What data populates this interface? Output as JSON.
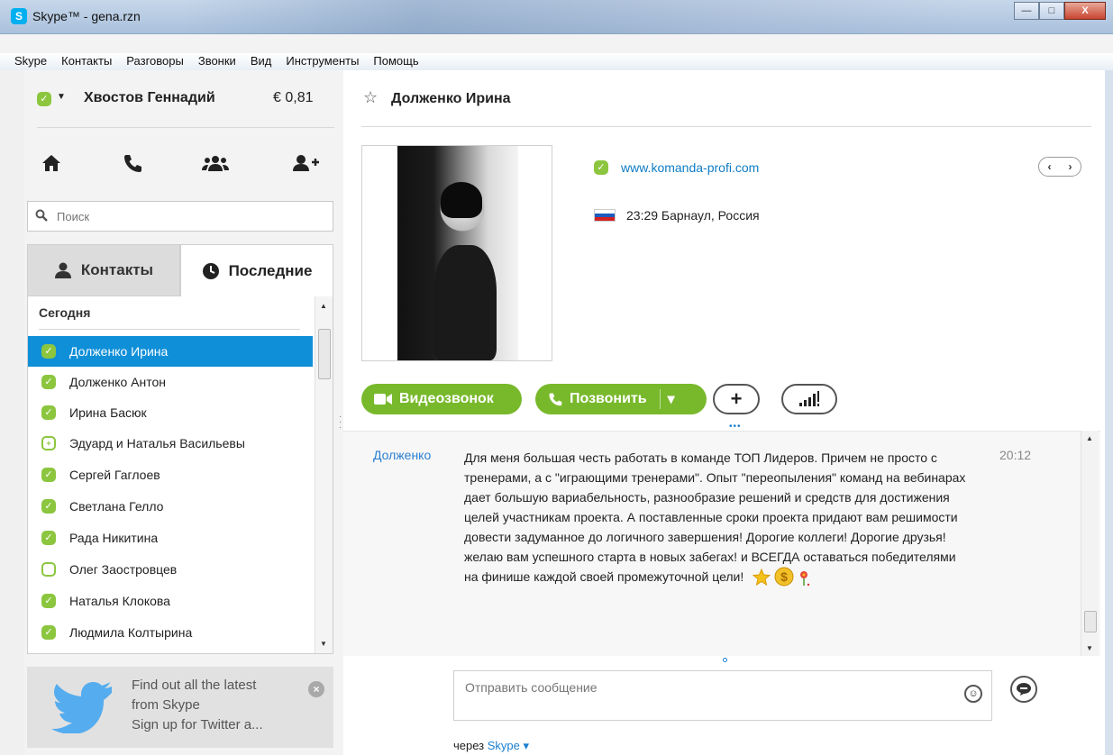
{
  "window": {
    "title": "Skype™ - gena.rzn",
    "logo_letter": "S",
    "minimize": "—",
    "maximize": "□",
    "close": "X"
  },
  "menu": [
    "Skype",
    "Контакты",
    "Разговоры",
    "Звонки",
    "Вид",
    "Инструменты",
    "Помощь"
  ],
  "profile": {
    "name": "Хвостов Геннадий",
    "credit": "€ 0,81",
    "status_color": "#8cc63f"
  },
  "search": {
    "placeholder": "Поиск"
  },
  "tabs": {
    "contacts": "Контакты",
    "recent": "Последние"
  },
  "recent_group": "Сегодня",
  "contacts": [
    {
      "name": "Долженко Ирина",
      "status": "online",
      "active": true
    },
    {
      "name": "Долженко Антон",
      "status": "online"
    },
    {
      "name": "Ирина Басюк",
      "status": "online"
    },
    {
      "name": "Эдуард и Наталья Васильевы",
      "status": "group"
    },
    {
      "name": "Сергей Гаглоев",
      "status": "online"
    },
    {
      "name": "Светлана Гелло",
      "status": "online"
    },
    {
      "name": "Рада Никитина",
      "status": "online"
    },
    {
      "name": "Олег  Заостровцев",
      "status": "offline"
    },
    {
      "name": "Наталья Клокова",
      "status": "online"
    },
    {
      "name": "Людмила Колтырина",
      "status": "online"
    }
  ],
  "twitter": {
    "line1": "Find out all the latest",
    "line2": "from Skype",
    "line3": "Sign up for Twitter a..."
  },
  "conversation": {
    "name": "Долженко Ирина",
    "website": "www.komanda-profi.com",
    "local_time": "23:29 Барнаул, Россия",
    "video_button": "Видеозвонок",
    "call_button": "Позвонить"
  },
  "message": {
    "author": "Долженко",
    "time": "20:12",
    "text": "Для меня большая честь работать в команде ТОП Лидеров. Причем не просто с тренерами, а с \"играющими тренерами\". Опыт \"переопыления\" команд на вебинарах дает большую вариабельность, разнообразие решений и средств для достижения целей участникам проекта. А поставленные сроки проекта придают вам решимости довести задуманное до логичного завершения! Дорогие коллеги! Дорогие друзья! желаю вам успешного старта в новых забегах! и ВСЕГДА оставаться победителями на финише каждой своей промежуточной цели!"
  },
  "composer": {
    "placeholder": "Отправить сообщение",
    "via_label": "через",
    "via_service": "Skype"
  },
  "colors": {
    "accent_blue": "#0f8fd8",
    "skype_green": "#78b92c"
  }
}
